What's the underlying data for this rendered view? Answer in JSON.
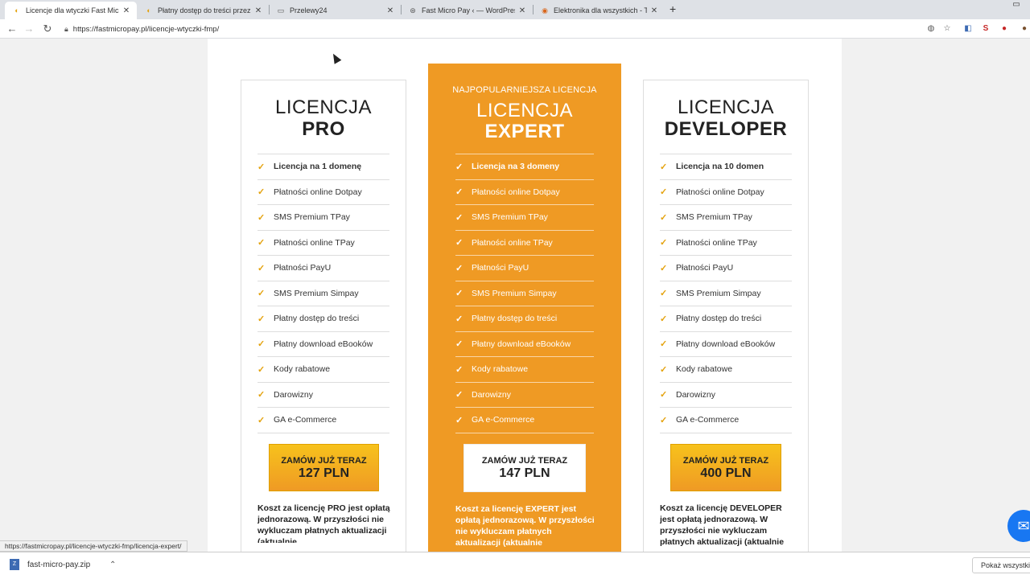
{
  "browser": {
    "tabs": [
      {
        "title": "Licencje dla wtyczki Fast Micro P…",
        "active": true
      },
      {
        "title": "Płatny dostęp do treści przez Pr…",
        "active": false
      },
      {
        "title": "Przelewy24",
        "active": false
      },
      {
        "title": "Fast Micro Pay ‹ — WordPress",
        "active": false
      },
      {
        "title": "Elektronika dla wszystkich - Trom…",
        "active": false
      }
    ],
    "new_tab": "+",
    "url": "https://fastmicropay.pl/licencje-wtyczki-fmp/",
    "status_url": "https://fastmicropay.pl/licencje-wtyczki-fmp/licencja-expert/"
  },
  "licenses": [
    {
      "key": "pro",
      "popular_label": "",
      "title_line1": "LICENCJA",
      "title_line2": "PRO",
      "features": [
        "Licencja na 1 domenę",
        "Płatności online Dotpay",
        "SMS Premium TPay",
        "Płatności online TPay",
        "Płatności PayU",
        "SMS Premium Simpay",
        "Płatny dostęp do treści",
        "Płatny download eBooków",
        "Kody rabatowe",
        "Darowizny",
        "GA e-Commerce"
      ],
      "order_label": "ZAMÓW JUŻ TERAZ",
      "price": "127 PLN",
      "note": "Koszt za licencję PRO jest opłatą jednorazową. W przyszłości nie wykluczam płatnych aktualizacji (aktualnie"
    },
    {
      "key": "expert",
      "popular_label": "NAJPOPULARNIEJSZA LICENCJA",
      "title_line1": "LICENCJA",
      "title_line2": "EXPERT",
      "features": [
        "Licencja na 3 domeny",
        "Płatności online Dotpay",
        "SMS Premium TPay",
        "Płatności online TPay",
        "Płatności PayU",
        "SMS Premium Simpay",
        "Płatny dostęp do treści",
        "Płatny download eBooków",
        "Kody rabatowe",
        "Darowizny",
        "GA e-Commerce"
      ],
      "order_label": "ZAMÓW JUŻ TERAZ",
      "price": "147 PLN",
      "note": "Koszt za licencję EXPERT jest opłatą jednorazową. W przyszłości nie wykluczam płatnych aktualizacji (aktualnie"
    },
    {
      "key": "developer",
      "popular_label": "",
      "title_line1": "LICENCJA",
      "title_line2": "DEVELOPER",
      "features": [
        "Licencja na 10 domen",
        "Płatności online Dotpay",
        "SMS Premium TPay",
        "Płatności online TPay",
        "Płatności PayU",
        "SMS Premium Simpay",
        "Płatny dostęp do treści",
        "Płatny download eBooków",
        "Kody rabatowe",
        "Darowizny",
        "GA e-Commerce"
      ],
      "order_label": "ZAMÓW JUŻ TERAZ",
      "price": "400 PLN",
      "note": "Koszt za licencję DEVELOPER jest opłatą jednorazową. W przyszłości nie wykluczam płatnych aktualizacji (aktualnie"
    }
  ],
  "downloads": {
    "file": "fast-micro-pay.zip",
    "show_all": "Pokaż wszystkie"
  },
  "colors": {
    "accent_orange": "#ef9a24",
    "button_yellow": "#f7c21c",
    "check_color": "#e4a20d"
  }
}
